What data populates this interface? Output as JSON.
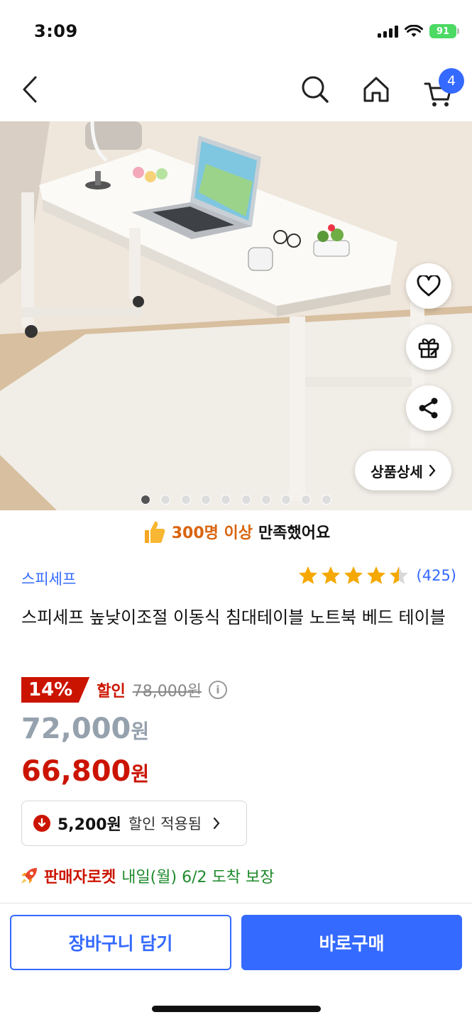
{
  "status_bar": {
    "time": "3:09",
    "battery": "91"
  },
  "nav": {
    "cart_count": "4"
  },
  "gallery": {
    "detail_label": "상품상세",
    "image_count": 10,
    "active_index": 0
  },
  "satisfaction": {
    "count_text": "300명 이상",
    "suffix": "만족했어요"
  },
  "product": {
    "brand": "스피세프",
    "rating_value": 4.5,
    "review_count": "(425)",
    "title": "스피세프 높낮이조절 이동식 침대테이블 노트북 베드 테이블"
  },
  "pricing": {
    "discount_rate": "14%",
    "discount_label": "할인",
    "original_price": "78,000원",
    "sale_price": "72,000",
    "final_price": "66,800",
    "currency": "원",
    "coupon_amount": "5,200원",
    "coupon_text": "할인 적용됨"
  },
  "delivery": {
    "badge": "판매자로켓",
    "text": "내일(월) 6/2 도착 보장"
  },
  "actions": {
    "cart_label": "장바구니 담기",
    "buy_label": "바로구매"
  },
  "colors": {
    "accent_blue": "#346aff",
    "discount_red": "#cb1400",
    "delivery_green": "#1e8a2b",
    "satisfaction_orange": "#d9640e"
  },
  "icons": [
    "back-icon",
    "search-icon",
    "home-icon",
    "cart-icon",
    "heart-icon",
    "gift-icon",
    "share-icon",
    "thumbs-up-icon",
    "star-icon",
    "info-icon",
    "coupon-down-icon",
    "rocket-icon",
    "chevron-right-icon"
  ]
}
